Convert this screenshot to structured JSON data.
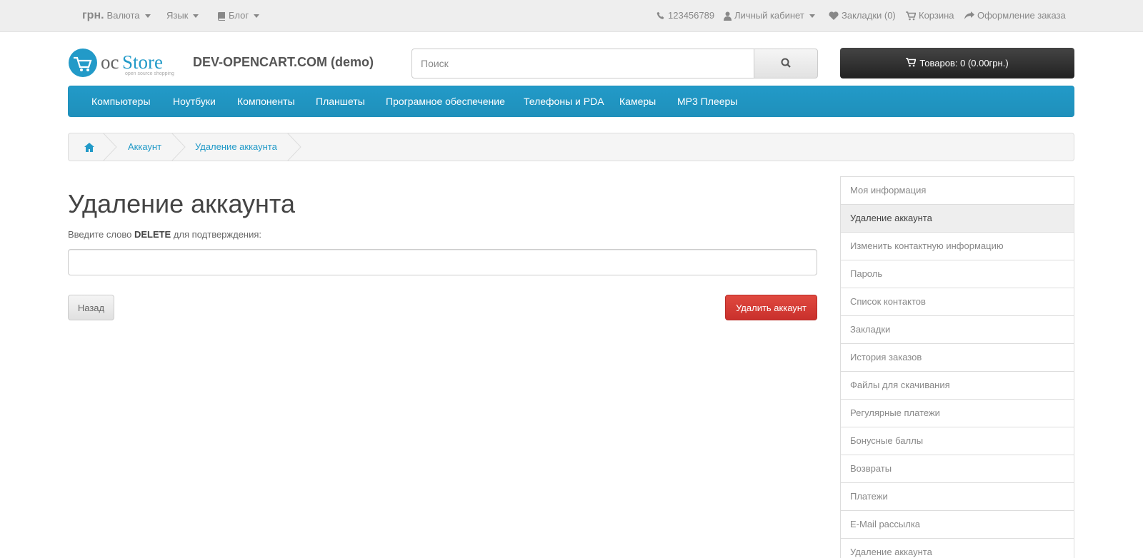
{
  "topbar": {
    "currency_symbol": "грн.",
    "currency_label": "Валюта",
    "language_label": "Язык",
    "blog_label": "Блог",
    "phone": "123456789",
    "account_label": "Личный кабинет",
    "wishlist_label": "Закладки (0)",
    "cart_label": "Корзина",
    "checkout_label": "Оформление заказа"
  },
  "header": {
    "logo_text_oc": "oc",
    "logo_text_store": "Store",
    "logo_tagline": "open source shopping",
    "store_name": "DEV-OPENCART.COM (demo)",
    "search_placeholder": "Поиск",
    "cart_total": "Товаров: 0 (0.00грн.)"
  },
  "menu": {
    "items": [
      "Компьютеры",
      "Ноутбуки",
      "Компоненты",
      "Планшеты",
      "Програмное обеспечение",
      "Телефоны и PDA",
      "Камеры",
      "MP3 Плееры"
    ]
  },
  "breadcrumb": {
    "items": [
      "Аккаунт",
      "Удаление аккаунта"
    ]
  },
  "main": {
    "title": "Удаление аккаунта",
    "label_before": "Введите слово ",
    "label_keyword": "DELETE",
    "label_after": " для подтверждения:",
    "confirm_value": "",
    "back_label": "Назад",
    "delete_label": "Удалить аккаунт"
  },
  "sidebar": {
    "active_index": 1,
    "items": [
      "Моя информация",
      "Удаление аккаунта",
      "Изменить контактную информацию",
      "Пароль",
      "Список контактов",
      "Закладки",
      "История заказов",
      "Файлы для скачивания",
      "Регулярные платежи",
      "Бонусные баллы",
      "Возвраты",
      "Платежи",
      "E-Mail рассылка",
      "Удаление аккаунта"
    ]
  },
  "colors": {
    "accent": "#229ac8",
    "danger": "#d9534f",
    "cart_bg": "#363636",
    "topbar_bg": "#eeeeee"
  }
}
